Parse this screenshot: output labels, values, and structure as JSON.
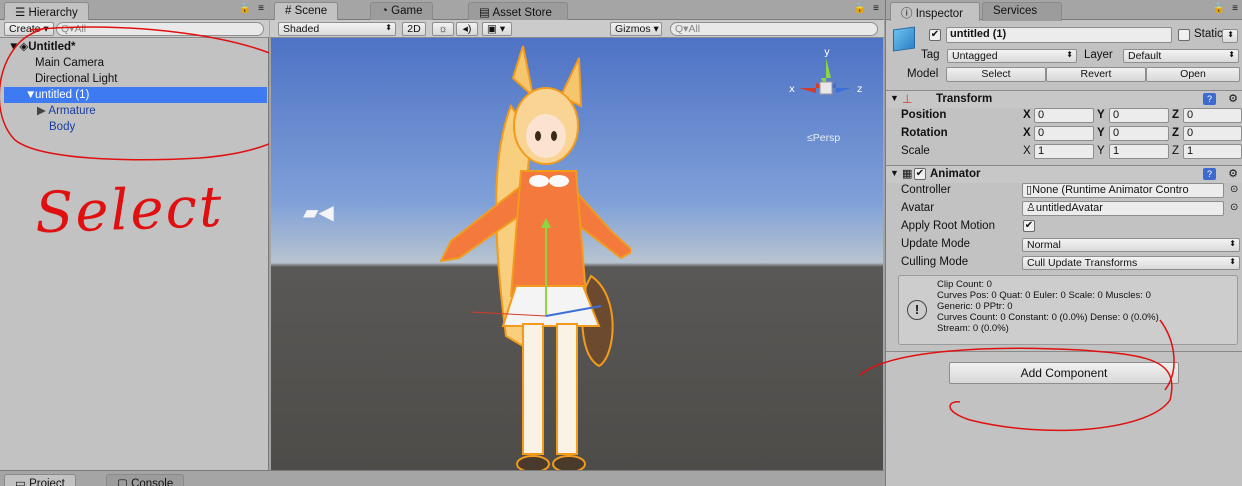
{
  "hierarchy": {
    "tab": "Hierarchy",
    "create_label": "Create",
    "search_placeholder": "Q▾All",
    "scene_name": "Untitled*",
    "items": [
      {
        "label": "Main Camera"
      },
      {
        "label": "Directional Light"
      },
      {
        "label": "untitled (1)"
      },
      {
        "label": "Armature"
      },
      {
        "label": "Body"
      }
    ]
  },
  "scene": {
    "tabs": [
      "Scene",
      "Game",
      "Asset Store"
    ],
    "shading": "Shaded",
    "mode_2d": "2D",
    "gizmos": "Gizmos",
    "search_placeholder": "Q▾All",
    "axis_x": "x",
    "axis_y": "y",
    "axis_z": "z",
    "persp": "≤Persp"
  },
  "inspector": {
    "tabs": [
      "Inspector",
      "Services"
    ],
    "object_name": "untitled (1)",
    "static_label": "Static",
    "tag_label": "Tag",
    "tag_value": "Untagged",
    "layer_label": "Layer",
    "layer_value": "Default",
    "model_label": "Model",
    "model_buttons": [
      "Select",
      "Revert",
      "Open"
    ],
    "transform": {
      "title": "Transform",
      "rows": [
        {
          "label": "Position",
          "x": "0",
          "y": "0",
          "z": "0"
        },
        {
          "label": "Rotation",
          "x": "0",
          "y": "0",
          "z": "0"
        },
        {
          "label": "Scale",
          "x": "1",
          "y": "1",
          "z": "1"
        }
      ],
      "axis": [
        "X",
        "Y",
        "Z"
      ]
    },
    "animator": {
      "title": "Animator",
      "controller_label": "Controller",
      "controller_value": "None (Runtime Animator Contro",
      "avatar_label": "Avatar",
      "avatar_value": "untitledAvatar",
      "apply_root_label": "Apply Root Motion",
      "update_mode_label": "Update Mode",
      "update_mode_value": "Normal",
      "culling_mode_label": "Culling Mode",
      "culling_mode_value": "Cull Update Transforms",
      "stats": [
        "Clip Count: 0",
        "Curves Pos: 0 Quat: 0 Euler: 0 Scale: 0 Muscles: 0",
        "Generic: 0 PPtr: 0",
        "Curves Count: 0 Constant: 0 (0.0%) Dense: 0 (0.0%)",
        "Stream: 0 (0.0%)"
      ]
    },
    "add_component": "Add Component"
  },
  "bottom_tabs": [
    "Project",
    "Console"
  ],
  "annotation": {
    "text": "Select",
    "color": "#e01010"
  },
  "colors": {
    "selection": "#3e7bf2",
    "scene_sky_top": "#4d73c4",
    "scene_ground": "#4f4d4a",
    "character_hair": "#f5c66e",
    "character_jacket": "#f37a3c"
  }
}
